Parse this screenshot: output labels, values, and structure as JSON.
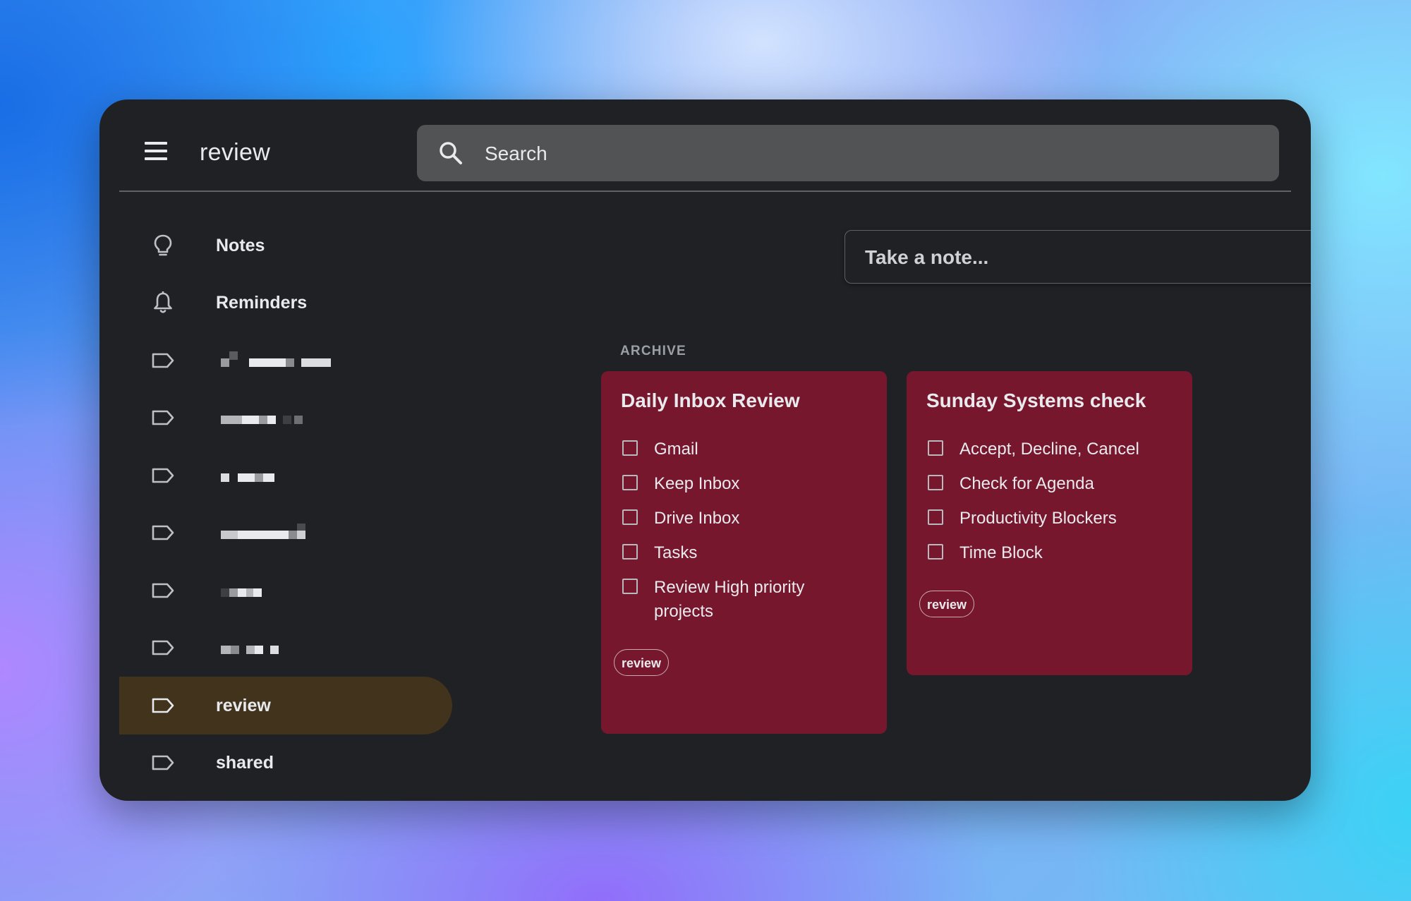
{
  "header": {
    "title": "review",
    "search": {
      "placeholder": "Search",
      "value": ""
    },
    "menu_icon": "hamburger-menu-icon",
    "search_icon": "search-icon"
  },
  "sidebar": {
    "items": [
      {
        "label": "Notes",
        "icon": "lightbulb-icon",
        "active": false
      },
      {
        "label": "Reminders",
        "icon": "bell-icon",
        "active": false
      },
      {
        "label": "",
        "icon": "label-icon",
        "active": false,
        "redacted": true
      },
      {
        "label": "",
        "icon": "label-icon",
        "active": false,
        "redacted": true
      },
      {
        "label": "",
        "icon": "label-icon",
        "active": false,
        "redacted": true
      },
      {
        "label": "",
        "icon": "label-icon",
        "active": false,
        "redacted": true
      },
      {
        "label": "",
        "icon": "label-icon",
        "active": false,
        "redacted": true
      },
      {
        "label": "",
        "icon": "label-icon",
        "active": false,
        "redacted": true
      },
      {
        "label": "review",
        "icon": "label-icon",
        "active": true
      },
      {
        "label": "shared",
        "icon": "label-icon",
        "active": false
      }
    ]
  },
  "main": {
    "take_note_placeholder": "Take a note...",
    "section_label": "ARCHIVE",
    "cards": [
      {
        "title": "Daily Inbox Review",
        "color": "#77172e",
        "items": [
          "Gmail",
          "Keep Inbox",
          "Drive Inbox",
          "Tasks",
          "Review High priority projects"
        ],
        "label_chip": "review"
      },
      {
        "title": "Sunday Systems check",
        "color": "#77172e",
        "items": [
          "Accept, Decline, Cancel",
          "Check for Agenda",
          "Productivity Blockers",
          "Time Block"
        ],
        "label_chip": "review"
      }
    ]
  },
  "colors": {
    "window_bg": "#202124",
    "search_bg": "#525355",
    "active_nav_bg": "#41331c",
    "card_bg": "#77172e",
    "text": "#e8eaed",
    "muted_text": "#9aa0a6"
  }
}
